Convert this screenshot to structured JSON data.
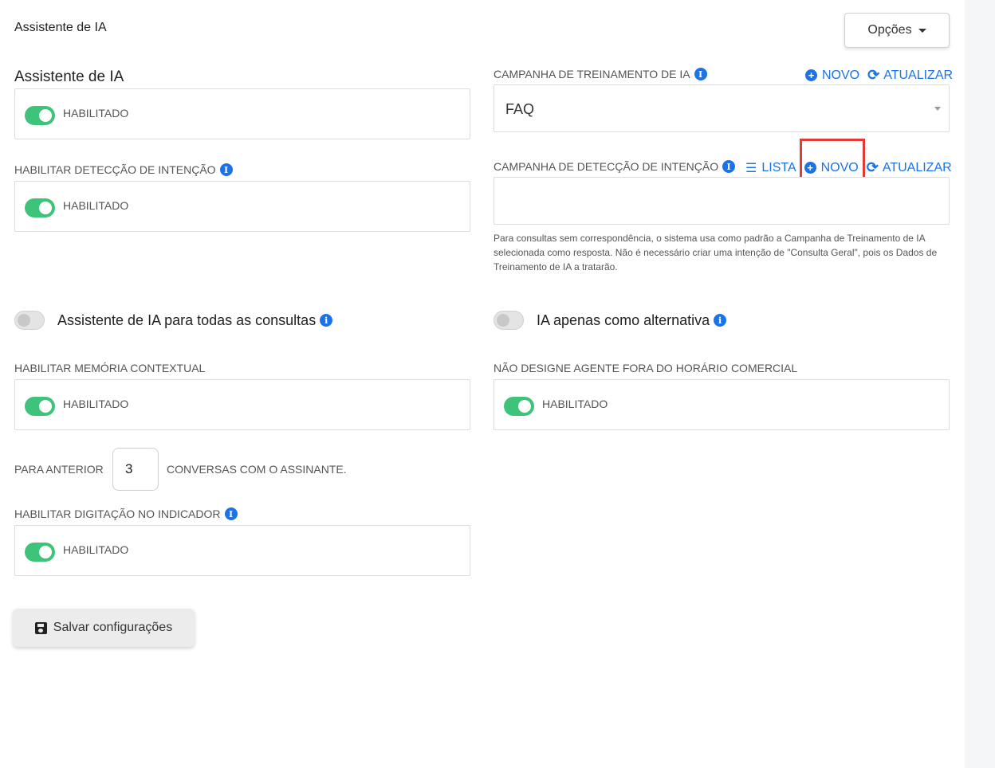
{
  "header": {
    "title": "Assistente de IA",
    "options_label": "Opções"
  },
  "left": {
    "section_title": "Assistente de IA",
    "assistant_toggle": {
      "text": "HABILITADO",
      "on": true
    },
    "intent_detection": {
      "label": "HABILITAR DETECÇÃO DE INTENÇÃO",
      "toggle_text": "HABILITADO",
      "on": true
    },
    "all_queries": {
      "label": "Assistente de IA para todas as consultas",
      "on": false
    },
    "context_memory": {
      "label": "HABILITAR MEMÓRIA CONTEXTUAL",
      "toggle_text": "HABILITADO",
      "on": true
    },
    "previous": {
      "prefix": "PARA ANTERIOR",
      "value": "3",
      "suffix": "CONVERSAS COM O ASSINANTE."
    },
    "typing_indicator": {
      "label": "HABILITAR DIGITAÇÃO NO INDICADOR",
      "toggle_text": "HABILITADO",
      "on": true
    },
    "save_label": "Salvar configurações"
  },
  "right": {
    "training_campaign": {
      "label": "CAMPANHA DE TREINAMENTO DE IA",
      "new_label": "NOVO",
      "refresh_label": "ATUALIZAR",
      "selected": "FAQ"
    },
    "intent_campaign": {
      "label": "CAMPANHA DE DETECÇÃO DE INTENÇÃO",
      "list_label": "LISTA",
      "new_label": "NOVO",
      "refresh_label": "ATUALIZAR",
      "value": "",
      "help": "Para consultas sem correspondência, o sistema usa como padrão a Campanha de Treinamento de IA selecionada como resposta. Não é necessário criar uma intenção de \"Consulta Geral\", pois os Dados de Treinamento de IA a tratarão."
    },
    "fallback_only": {
      "label": "IA apenas como alternativa",
      "on": false
    },
    "no_agent_after_hours": {
      "label": "NÃO DESIGNE AGENTE FORA DO HORÁRIO COMERCIAL",
      "toggle_text": "HABILITADO",
      "on": true
    }
  },
  "colors": {
    "accent": "#1a73e8",
    "toggle_on": "#3ec47a",
    "highlight": "#e53935"
  }
}
